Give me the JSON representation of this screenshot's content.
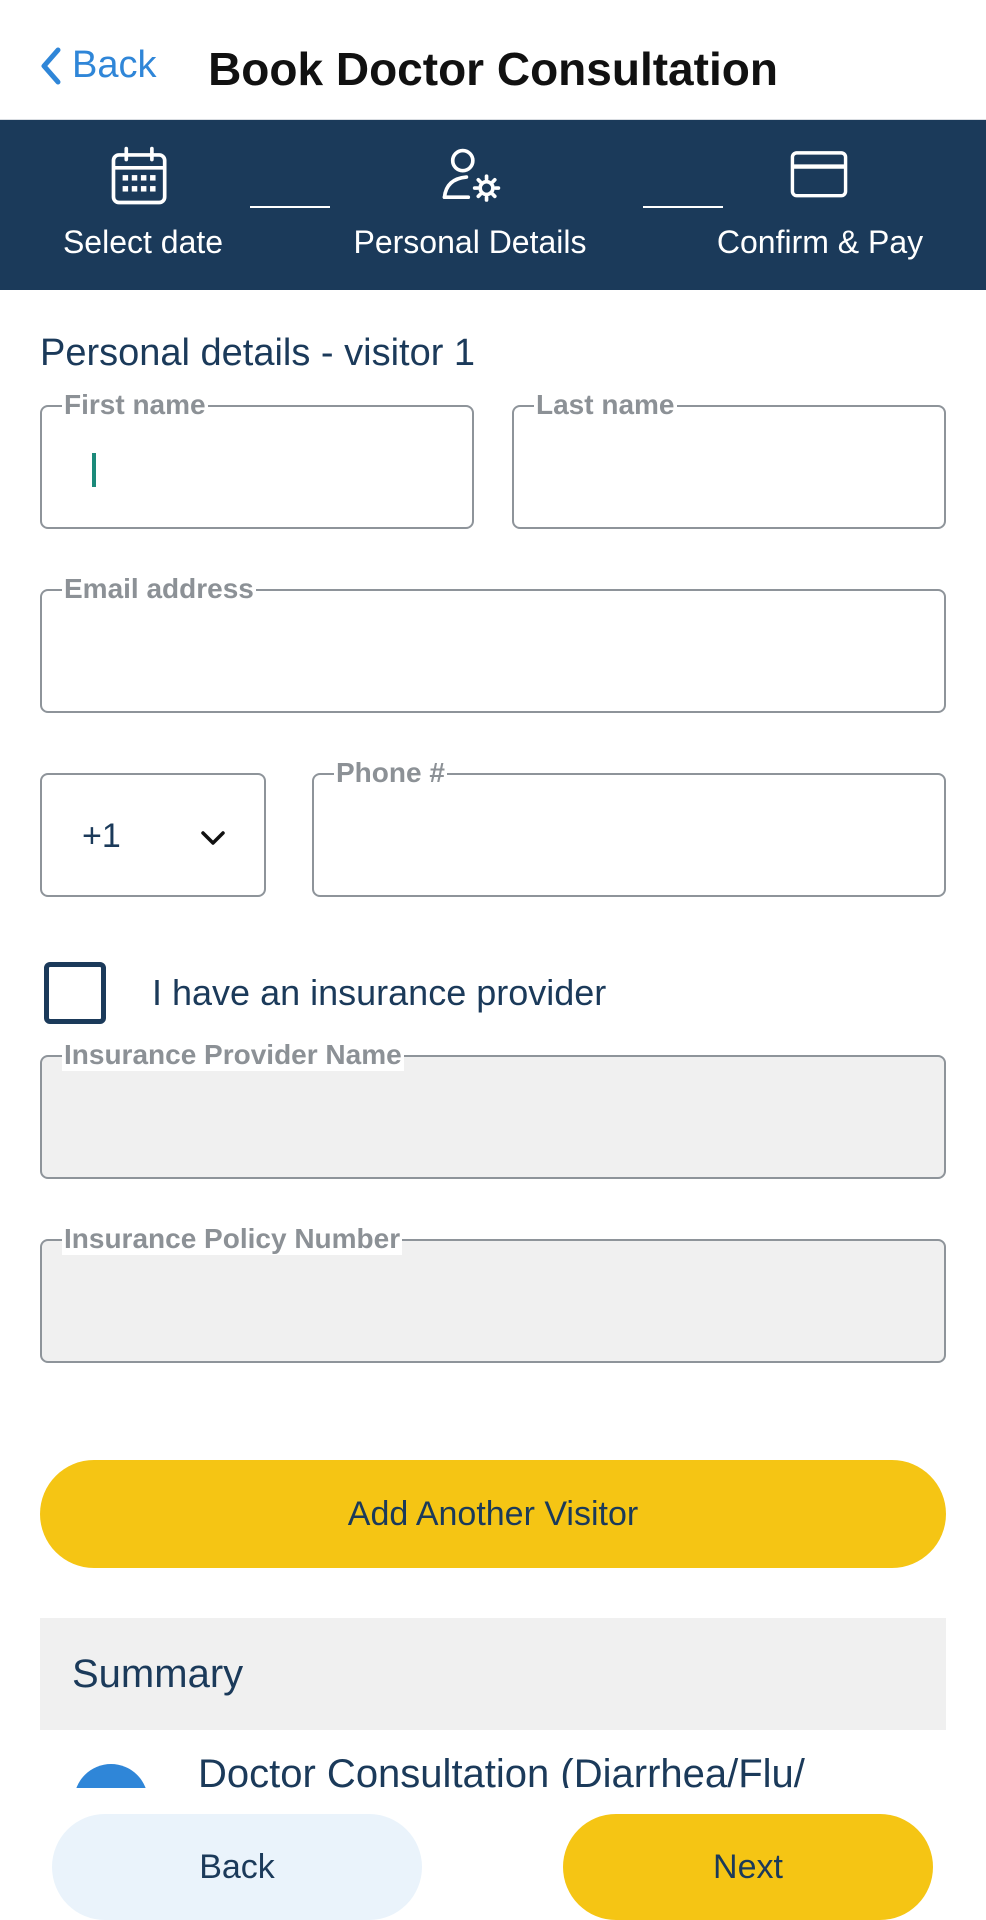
{
  "header": {
    "back_label": "Back",
    "title": "Book Doctor Consultation"
  },
  "stepper": {
    "steps": [
      {
        "label": "Select date",
        "icon": "calendar-icon"
      },
      {
        "label": "Personal Details",
        "icon": "user-settings-icon"
      },
      {
        "label": "Confirm & Pay",
        "icon": "credit-card-icon"
      }
    ]
  },
  "form": {
    "section_title": "Personal details - visitor 1",
    "first_name": {
      "label": "First name",
      "value": ""
    },
    "last_name": {
      "label": "Last name",
      "value": ""
    },
    "email": {
      "label": "Email address",
      "value": ""
    },
    "country_code": {
      "value": "+1"
    },
    "phone": {
      "label": "Phone #",
      "value": ""
    },
    "insurance_checkbox": {
      "label": "I have an insurance provider",
      "checked": false
    },
    "insurance_provider": {
      "label": "Insurance Provider Name",
      "value": "",
      "disabled": true
    },
    "insurance_policy": {
      "label": "Insurance Policy Number",
      "value": "",
      "disabled": true
    },
    "add_visitor_label": "Add Another Visitor"
  },
  "summary": {
    "title": "Summary",
    "item": "Doctor Consultation (Diarrhea/Flu/"
  },
  "footer": {
    "back_label": "Back",
    "next_label": "Next"
  },
  "colors": {
    "primary_dark": "#1b3a5a",
    "accent_yellow": "#f5c514",
    "link_blue": "#2f86d8",
    "caret_teal": "#1b8a7a"
  }
}
